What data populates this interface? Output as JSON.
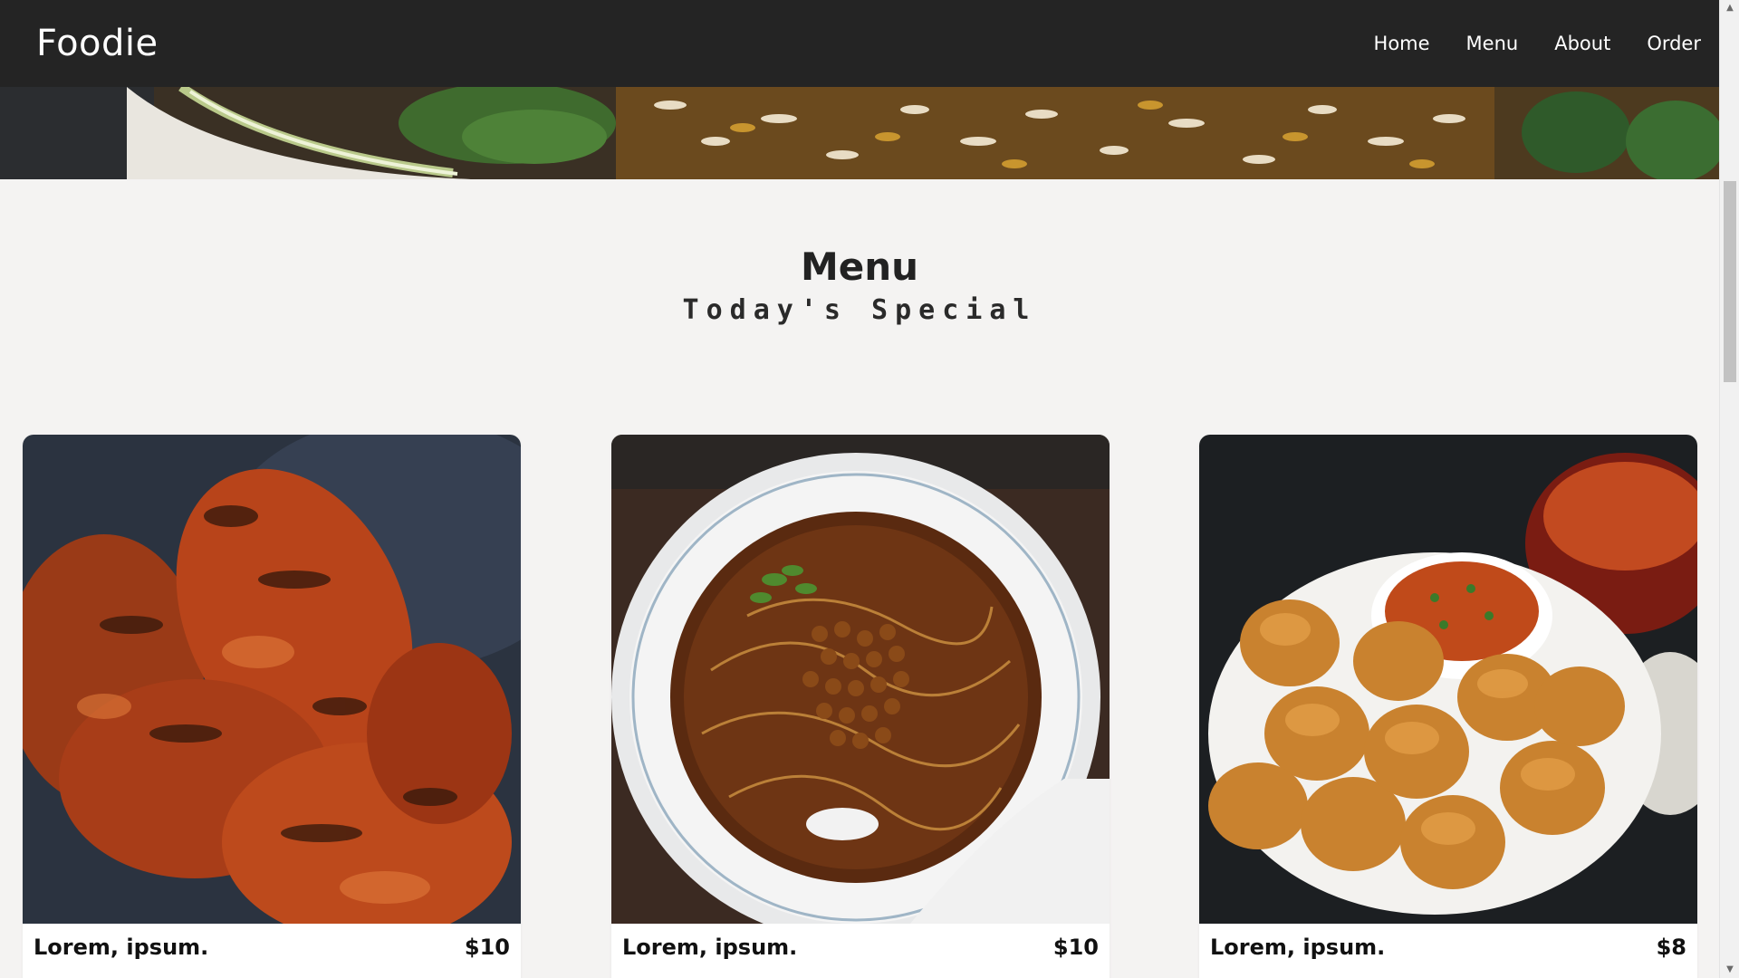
{
  "brand": "Foodie",
  "nav": [
    {
      "label": "Home"
    },
    {
      "label": "Menu"
    },
    {
      "label": "About"
    },
    {
      "label": "Order"
    }
  ],
  "section": {
    "title": "Menu",
    "subtitle": "Today's Special"
  },
  "cards": [
    {
      "name": "Lorem, ipsum.",
      "price": "$10",
      "image": "tandoori-chicken"
    },
    {
      "name": "Lorem, ipsum.",
      "price": "$10",
      "image": "noodle-soup"
    },
    {
      "name": "Lorem, ipsum.",
      "price": "$8",
      "image": "pav-bhaji"
    }
  ],
  "colors": {
    "header_bg": "#242424",
    "page_bg": "#f4f3f2",
    "card_bg": "#ffffff"
  }
}
